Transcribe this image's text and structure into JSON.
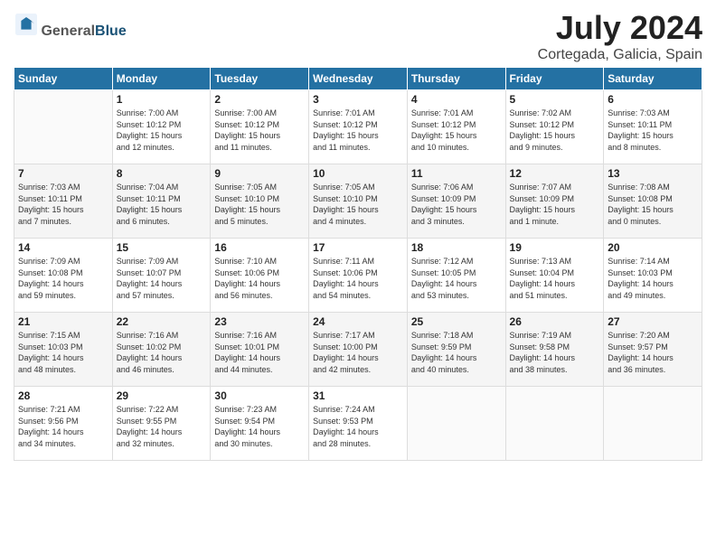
{
  "header": {
    "logo_general": "General",
    "logo_blue": "Blue",
    "title": "July 2024",
    "location": "Cortegada, Galicia, Spain"
  },
  "days_of_week": [
    "Sunday",
    "Monday",
    "Tuesday",
    "Wednesday",
    "Thursday",
    "Friday",
    "Saturday"
  ],
  "weeks": [
    [
      {
        "day": "",
        "info": ""
      },
      {
        "day": "1",
        "info": "Sunrise: 7:00 AM\nSunset: 10:12 PM\nDaylight: 15 hours\nand 12 minutes."
      },
      {
        "day": "2",
        "info": "Sunrise: 7:00 AM\nSunset: 10:12 PM\nDaylight: 15 hours\nand 11 minutes."
      },
      {
        "day": "3",
        "info": "Sunrise: 7:01 AM\nSunset: 10:12 PM\nDaylight: 15 hours\nand 11 minutes."
      },
      {
        "day": "4",
        "info": "Sunrise: 7:01 AM\nSunset: 10:12 PM\nDaylight: 15 hours\nand 10 minutes."
      },
      {
        "day": "5",
        "info": "Sunrise: 7:02 AM\nSunset: 10:12 PM\nDaylight: 15 hours\nand 9 minutes."
      },
      {
        "day": "6",
        "info": "Sunrise: 7:03 AM\nSunset: 10:11 PM\nDaylight: 15 hours\nand 8 minutes."
      }
    ],
    [
      {
        "day": "7",
        "info": "Sunrise: 7:03 AM\nSunset: 10:11 PM\nDaylight: 15 hours\nand 7 minutes."
      },
      {
        "day": "8",
        "info": "Sunrise: 7:04 AM\nSunset: 10:11 PM\nDaylight: 15 hours\nand 6 minutes."
      },
      {
        "day": "9",
        "info": "Sunrise: 7:05 AM\nSunset: 10:10 PM\nDaylight: 15 hours\nand 5 minutes."
      },
      {
        "day": "10",
        "info": "Sunrise: 7:05 AM\nSunset: 10:10 PM\nDaylight: 15 hours\nand 4 minutes."
      },
      {
        "day": "11",
        "info": "Sunrise: 7:06 AM\nSunset: 10:09 PM\nDaylight: 15 hours\nand 3 minutes."
      },
      {
        "day": "12",
        "info": "Sunrise: 7:07 AM\nSunset: 10:09 PM\nDaylight: 15 hours\nand 1 minute."
      },
      {
        "day": "13",
        "info": "Sunrise: 7:08 AM\nSunset: 10:08 PM\nDaylight: 15 hours\nand 0 minutes."
      }
    ],
    [
      {
        "day": "14",
        "info": "Sunrise: 7:09 AM\nSunset: 10:08 PM\nDaylight: 14 hours\nand 59 minutes."
      },
      {
        "day": "15",
        "info": "Sunrise: 7:09 AM\nSunset: 10:07 PM\nDaylight: 14 hours\nand 57 minutes."
      },
      {
        "day": "16",
        "info": "Sunrise: 7:10 AM\nSunset: 10:06 PM\nDaylight: 14 hours\nand 56 minutes."
      },
      {
        "day": "17",
        "info": "Sunrise: 7:11 AM\nSunset: 10:06 PM\nDaylight: 14 hours\nand 54 minutes."
      },
      {
        "day": "18",
        "info": "Sunrise: 7:12 AM\nSunset: 10:05 PM\nDaylight: 14 hours\nand 53 minutes."
      },
      {
        "day": "19",
        "info": "Sunrise: 7:13 AM\nSunset: 10:04 PM\nDaylight: 14 hours\nand 51 minutes."
      },
      {
        "day": "20",
        "info": "Sunrise: 7:14 AM\nSunset: 10:03 PM\nDaylight: 14 hours\nand 49 minutes."
      }
    ],
    [
      {
        "day": "21",
        "info": "Sunrise: 7:15 AM\nSunset: 10:03 PM\nDaylight: 14 hours\nand 48 minutes."
      },
      {
        "day": "22",
        "info": "Sunrise: 7:16 AM\nSunset: 10:02 PM\nDaylight: 14 hours\nand 46 minutes."
      },
      {
        "day": "23",
        "info": "Sunrise: 7:16 AM\nSunset: 10:01 PM\nDaylight: 14 hours\nand 44 minutes."
      },
      {
        "day": "24",
        "info": "Sunrise: 7:17 AM\nSunset: 10:00 PM\nDaylight: 14 hours\nand 42 minutes."
      },
      {
        "day": "25",
        "info": "Sunrise: 7:18 AM\nSunset: 9:59 PM\nDaylight: 14 hours\nand 40 minutes."
      },
      {
        "day": "26",
        "info": "Sunrise: 7:19 AM\nSunset: 9:58 PM\nDaylight: 14 hours\nand 38 minutes."
      },
      {
        "day": "27",
        "info": "Sunrise: 7:20 AM\nSunset: 9:57 PM\nDaylight: 14 hours\nand 36 minutes."
      }
    ],
    [
      {
        "day": "28",
        "info": "Sunrise: 7:21 AM\nSunset: 9:56 PM\nDaylight: 14 hours\nand 34 minutes."
      },
      {
        "day": "29",
        "info": "Sunrise: 7:22 AM\nSunset: 9:55 PM\nDaylight: 14 hours\nand 32 minutes."
      },
      {
        "day": "30",
        "info": "Sunrise: 7:23 AM\nSunset: 9:54 PM\nDaylight: 14 hours\nand 30 minutes."
      },
      {
        "day": "31",
        "info": "Sunrise: 7:24 AM\nSunset: 9:53 PM\nDaylight: 14 hours\nand 28 minutes."
      },
      {
        "day": "",
        "info": ""
      },
      {
        "day": "",
        "info": ""
      },
      {
        "day": "",
        "info": ""
      }
    ]
  ]
}
